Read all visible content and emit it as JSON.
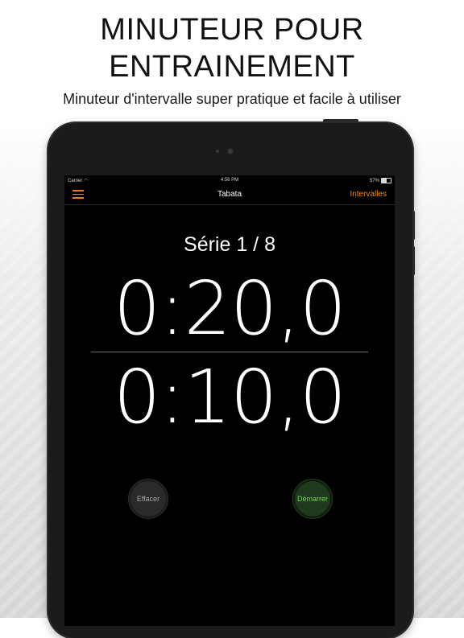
{
  "promo": {
    "headline_line1": "MINUTEUR POUR",
    "headline_line2": "ENTRAINEMENT",
    "subtitle": "Minuteur d'intervalle super pratique et facile à utiliser"
  },
  "status_bar": {
    "carrier": "Carrier",
    "time": "4:56 PM",
    "battery": "57%",
    "battery_level": 0.57
  },
  "nav": {
    "title": "Tabata",
    "right_label": "Intervalles",
    "menu_icon": "hamburger-menu-icon",
    "accent_color": "#f0891a"
  },
  "timer": {
    "series_label": "Série 1 / 8",
    "work_time": "0:20,0",
    "rest_time": "0:10,0"
  },
  "controls": {
    "clear_label": "Effacer",
    "start_label": "Démarrer",
    "start_color": "#6fd85a"
  }
}
